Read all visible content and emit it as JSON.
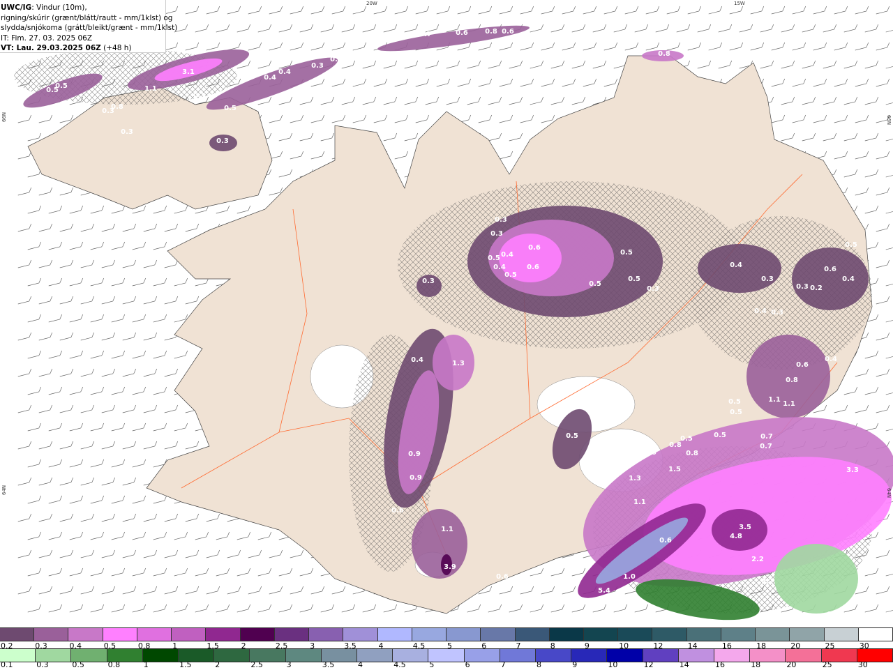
{
  "header": {
    "model": "UWC/IG",
    "line1_rest": ": Vindur (10m),",
    "line2": "rigning/skúrir (grænt/blátt/rautt - mm/1klst) og",
    "line3": "slydda/snjókoma (grátt/bleikt/grænt - mm/1klst)",
    "it": "IT: Fim. 27. 03. 2025 06Z",
    "vt_bold": "VT: Lau. 29.03.2025 06Z",
    "vt_lead": "(+48 h)"
  },
  "axes": {
    "lon_20": "20W",
    "lon_15": "15W",
    "lat_66_left": "66N",
    "lat_64_left": "64N",
    "lat_66_right": "66N",
    "lat_64_right": "64N"
  },
  "colors": {
    "land": "#f0e2d4",
    "sea": "#ffffff",
    "roads": "#ff6a30"
  },
  "map_values": [
    "0.5",
    "0.5",
    "0.3",
    "0.8",
    "0.3",
    "1.1",
    "3.1",
    "0.3",
    "0.5",
    "0.4",
    "0.4",
    "0.3",
    "0.5",
    "0.7",
    "0.6",
    "0.8",
    "0.6",
    "0.8",
    "0.3",
    "0.3",
    "0.3",
    "0.5",
    "0.4",
    "0.4",
    "0.5",
    "0.6",
    "0.6",
    "0.5",
    "0.5",
    "0.5",
    "0.3",
    "0.3",
    "0.4",
    "0.3",
    "0.3",
    "0.4",
    "0.3",
    "0.2",
    "0.6",
    "0.4",
    "0.5",
    "0.4",
    "1.3",
    "0.4",
    "0.9",
    "0.9",
    "0.6",
    "1.1",
    "3.9",
    "0.5",
    "0.6",
    "0.8",
    "0.8",
    "1.1",
    "1.1",
    "0.5",
    "0.5",
    "0.5",
    "0.5",
    "0.7",
    "0.7",
    "0.8",
    "0.6",
    "1.3",
    "1.1",
    "1.5",
    "3.3",
    "0.6",
    "1.0",
    "5.4",
    "3.5",
    "4.8",
    "2.2",
    "2.2",
    "1.0",
    "1.1",
    "0.5",
    "0.6",
    "0.4"
  ],
  "snow_scale": {
    "labels": [
      "0.2",
      "0.3",
      "0.4",
      "0.5",
      "0.8",
      "1",
      "1.5",
      "2",
      "2.5",
      "3",
      "3.5",
      "4",
      "4.5",
      "5",
      "6",
      "7",
      "8",
      "9",
      "10",
      "12",
      "14",
      "16",
      "18",
      "20",
      "25",
      "30"
    ],
    "colors": [
      "#6e4a70",
      "#9a609a",
      "#c878c8",
      "#ff80ff",
      "#e070e0",
      "#c060c0",
      "#902890",
      "#500050",
      "#6a3080",
      "#8860b0",
      "#a090d8",
      "#b0b8ff",
      "#98a8e0",
      "#8898d0",
      "#6878a8",
      "#3a5878",
      "#0a3848",
      "#134550",
      "#1a4a58",
      "#2e5a66",
      "#4a7078",
      "#5e8088",
      "#7a9498",
      "#90a4a8",
      "#c8d0d4",
      "#ffffff"
    ]
  },
  "rain_scale": {
    "labels": [
      "0.1",
      "0.3",
      "0.5",
      "0.8",
      "1",
      "1.5",
      "2",
      "2.5",
      "3",
      "3.5",
      "4",
      "4.5",
      "5",
      "6",
      "7",
      "8",
      "9",
      "10",
      "12",
      "14",
      "16",
      "18",
      "20",
      "25",
      "30"
    ],
    "colors": [
      "#ccffcc",
      "#a0d8a0",
      "#70b070",
      "#308030",
      "#004800",
      "#1a5a28",
      "#2e6840",
      "#487860",
      "#5e8880",
      "#7890a0",
      "#90a0c0",
      "#a8b0e0",
      "#c0c4ff",
      "#98a0e8",
      "#7078d8",
      "#4848c8",
      "#2828b8",
      "#0000a8",
      "#6040c0",
      "#c090e0",
      "#f4a8ec",
      "#f490c8",
      "#f47098",
      "#f03850",
      "#ff0000"
    ]
  }
}
